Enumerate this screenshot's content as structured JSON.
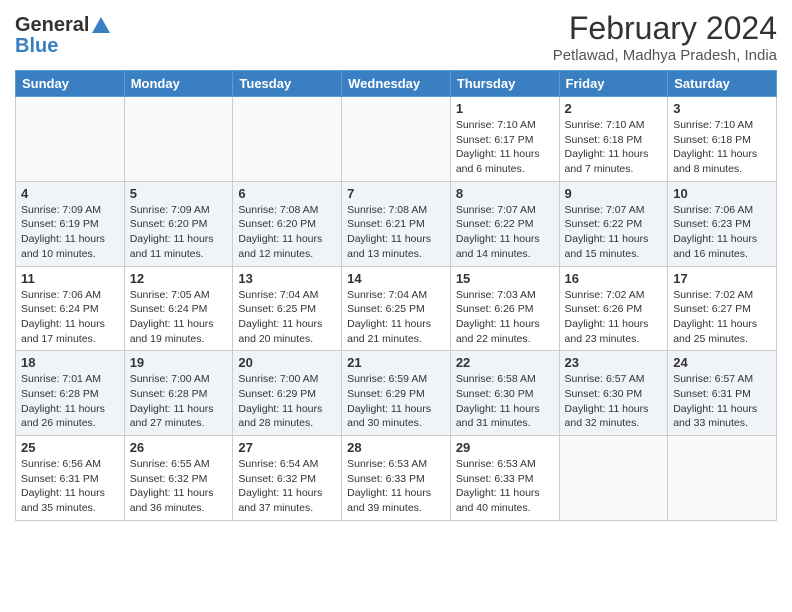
{
  "header": {
    "logo_line1": "General",
    "logo_line2": "Blue",
    "title": "February 2024",
    "subtitle": "Petlawad, Madhya Pradesh, India"
  },
  "weekdays": [
    "Sunday",
    "Monday",
    "Tuesday",
    "Wednesday",
    "Thursday",
    "Friday",
    "Saturday"
  ],
  "weeks": [
    [
      {
        "day": "",
        "info": ""
      },
      {
        "day": "",
        "info": ""
      },
      {
        "day": "",
        "info": ""
      },
      {
        "day": "",
        "info": ""
      },
      {
        "day": "1",
        "info": "Sunrise: 7:10 AM\nSunset: 6:17 PM\nDaylight: 11 hours and 6 minutes."
      },
      {
        "day": "2",
        "info": "Sunrise: 7:10 AM\nSunset: 6:18 PM\nDaylight: 11 hours and 7 minutes."
      },
      {
        "day": "3",
        "info": "Sunrise: 7:10 AM\nSunset: 6:18 PM\nDaylight: 11 hours and 8 minutes."
      }
    ],
    [
      {
        "day": "4",
        "info": "Sunrise: 7:09 AM\nSunset: 6:19 PM\nDaylight: 11 hours and 10 minutes."
      },
      {
        "day": "5",
        "info": "Sunrise: 7:09 AM\nSunset: 6:20 PM\nDaylight: 11 hours and 11 minutes."
      },
      {
        "day": "6",
        "info": "Sunrise: 7:08 AM\nSunset: 6:20 PM\nDaylight: 11 hours and 12 minutes."
      },
      {
        "day": "7",
        "info": "Sunrise: 7:08 AM\nSunset: 6:21 PM\nDaylight: 11 hours and 13 minutes."
      },
      {
        "day": "8",
        "info": "Sunrise: 7:07 AM\nSunset: 6:22 PM\nDaylight: 11 hours and 14 minutes."
      },
      {
        "day": "9",
        "info": "Sunrise: 7:07 AM\nSunset: 6:22 PM\nDaylight: 11 hours and 15 minutes."
      },
      {
        "day": "10",
        "info": "Sunrise: 7:06 AM\nSunset: 6:23 PM\nDaylight: 11 hours and 16 minutes."
      }
    ],
    [
      {
        "day": "11",
        "info": "Sunrise: 7:06 AM\nSunset: 6:24 PM\nDaylight: 11 hours and 17 minutes."
      },
      {
        "day": "12",
        "info": "Sunrise: 7:05 AM\nSunset: 6:24 PM\nDaylight: 11 hours and 19 minutes."
      },
      {
        "day": "13",
        "info": "Sunrise: 7:04 AM\nSunset: 6:25 PM\nDaylight: 11 hours and 20 minutes."
      },
      {
        "day": "14",
        "info": "Sunrise: 7:04 AM\nSunset: 6:25 PM\nDaylight: 11 hours and 21 minutes."
      },
      {
        "day": "15",
        "info": "Sunrise: 7:03 AM\nSunset: 6:26 PM\nDaylight: 11 hours and 22 minutes."
      },
      {
        "day": "16",
        "info": "Sunrise: 7:02 AM\nSunset: 6:26 PM\nDaylight: 11 hours and 23 minutes."
      },
      {
        "day": "17",
        "info": "Sunrise: 7:02 AM\nSunset: 6:27 PM\nDaylight: 11 hours and 25 minutes."
      }
    ],
    [
      {
        "day": "18",
        "info": "Sunrise: 7:01 AM\nSunset: 6:28 PM\nDaylight: 11 hours and 26 minutes."
      },
      {
        "day": "19",
        "info": "Sunrise: 7:00 AM\nSunset: 6:28 PM\nDaylight: 11 hours and 27 minutes."
      },
      {
        "day": "20",
        "info": "Sunrise: 7:00 AM\nSunset: 6:29 PM\nDaylight: 11 hours and 28 minutes."
      },
      {
        "day": "21",
        "info": "Sunrise: 6:59 AM\nSunset: 6:29 PM\nDaylight: 11 hours and 30 minutes."
      },
      {
        "day": "22",
        "info": "Sunrise: 6:58 AM\nSunset: 6:30 PM\nDaylight: 11 hours and 31 minutes."
      },
      {
        "day": "23",
        "info": "Sunrise: 6:57 AM\nSunset: 6:30 PM\nDaylight: 11 hours and 32 minutes."
      },
      {
        "day": "24",
        "info": "Sunrise: 6:57 AM\nSunset: 6:31 PM\nDaylight: 11 hours and 33 minutes."
      }
    ],
    [
      {
        "day": "25",
        "info": "Sunrise: 6:56 AM\nSunset: 6:31 PM\nDaylight: 11 hours and 35 minutes."
      },
      {
        "day": "26",
        "info": "Sunrise: 6:55 AM\nSunset: 6:32 PM\nDaylight: 11 hours and 36 minutes."
      },
      {
        "day": "27",
        "info": "Sunrise: 6:54 AM\nSunset: 6:32 PM\nDaylight: 11 hours and 37 minutes."
      },
      {
        "day": "28",
        "info": "Sunrise: 6:53 AM\nSunset: 6:33 PM\nDaylight: 11 hours and 39 minutes."
      },
      {
        "day": "29",
        "info": "Sunrise: 6:53 AM\nSunset: 6:33 PM\nDaylight: 11 hours and 40 minutes."
      },
      {
        "day": "",
        "info": ""
      },
      {
        "day": "",
        "info": ""
      }
    ]
  ]
}
